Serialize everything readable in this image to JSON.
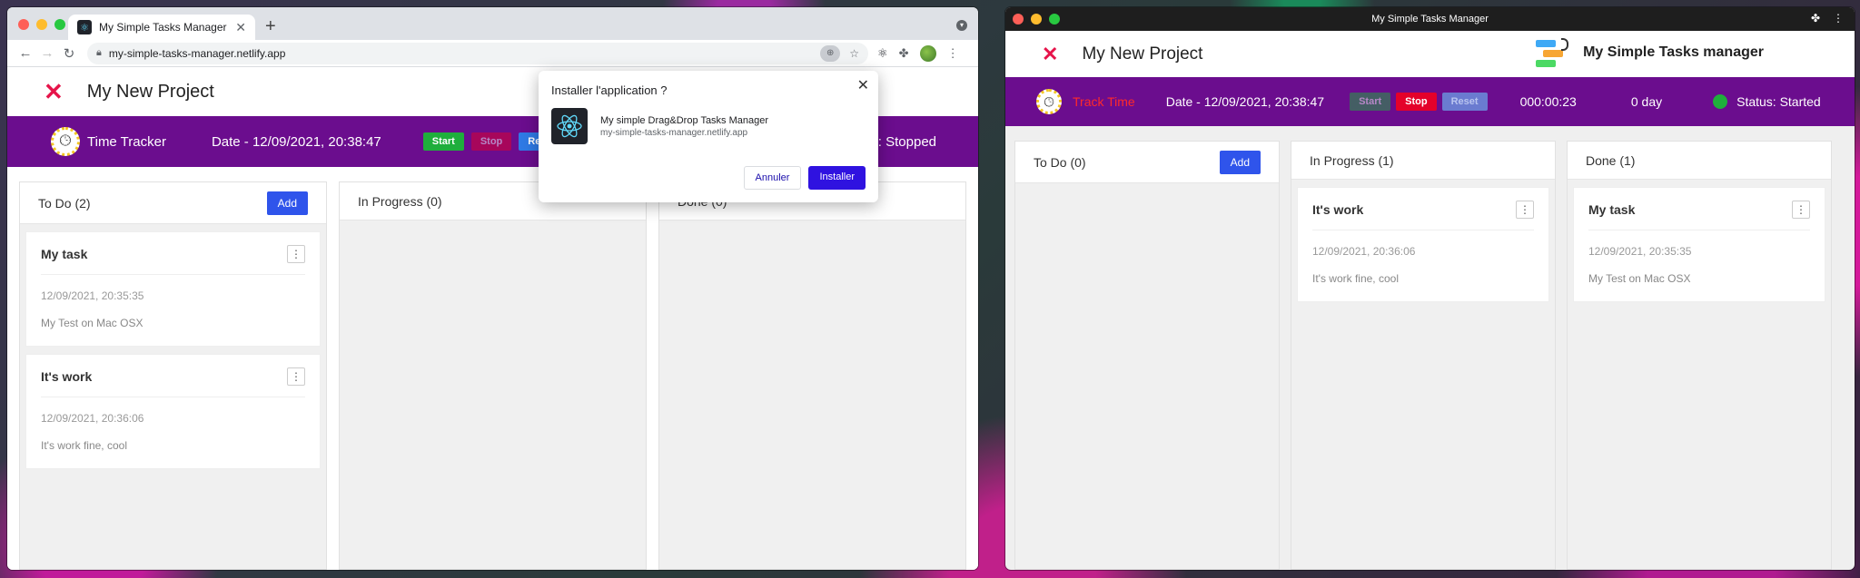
{
  "left": {
    "tab_title": "My Simple Tasks Manager",
    "tab_close": "✕",
    "new_tab": "+",
    "url": "my-simple-tasks-manager.netlify.app",
    "project_title": "My New Project",
    "tracker_label": "Time Tracker",
    "date": "Date - 12/09/2021, 20:38:47",
    "btn_start": "Start",
    "btn_stop": "Stop",
    "btn_reset": "Re",
    "status_partial": "s: Stopped",
    "columns": [
      {
        "title": "To Do (2)",
        "add": "Add"
      },
      {
        "title": "In Progress (0)"
      },
      {
        "title": "Done (0)"
      }
    ],
    "todo_cards": [
      {
        "title": "My task",
        "date": "12/09/2021, 20:35:35",
        "desc": "My Test on Mac OSX"
      },
      {
        "title": "It's work",
        "date": "12/09/2021, 20:36:06",
        "desc": "It's work fine, cool"
      }
    ],
    "dialog": {
      "title": "Installer l'application ?",
      "app_name": "My simple Drag&Drop Tasks Manager",
      "app_url": "my-simple-tasks-manager.netlify.app",
      "cancel": "Annuler",
      "install": "Installer"
    }
  },
  "right": {
    "window_title": "My Simple Tasks Manager",
    "project_title": "My New Project",
    "brand": "My Simple Tasks manager",
    "track_time": "Track Time",
    "date": "Date - 12/09/2021, 20:38:47",
    "btn_start": "Start",
    "btn_stop": "Stop",
    "btn_reset": "Reset",
    "elapsed": "000:00:23",
    "days": "0 day",
    "status": "Status: Started",
    "status_color": "#1fae3c",
    "columns": [
      {
        "title": "To Do (0)",
        "add": "Add"
      },
      {
        "title": "In Progress (1)"
      },
      {
        "title": "Done (1)"
      }
    ],
    "progress_card": {
      "title": "It's work",
      "date": "12/09/2021, 20:36:06",
      "desc": "It's work fine, cool"
    },
    "done_card": {
      "title": "My task",
      "date": "12/09/2021, 20:35:35",
      "desc": "My Test on Mac OSX"
    }
  },
  "icons": {
    "kebab": "⋮",
    "close_x": "✕"
  },
  "colors": {
    "purple": "#6b0d8e",
    "add_blue": "#2f54eb",
    "close_red": "#e6144a"
  }
}
